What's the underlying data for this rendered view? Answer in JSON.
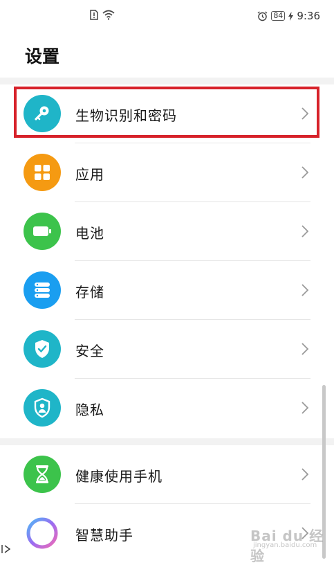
{
  "status_bar": {
    "time": "9:36",
    "battery": "84"
  },
  "header": {
    "title": "设置"
  },
  "settings": {
    "items": [
      {
        "label": "生物识别和密码",
        "icon": "key-icon",
        "color": "#1fb5c8"
      },
      {
        "label": "应用",
        "icon": "apps-grid-icon",
        "color": "#f59a12"
      },
      {
        "label": "电池",
        "icon": "battery-icon",
        "color": "#3cc34b"
      },
      {
        "label": "存储",
        "icon": "storage-icon",
        "color": "#1a9ef0"
      },
      {
        "label": "安全",
        "icon": "shield-check-icon",
        "color": "#1fb5c8"
      },
      {
        "label": "隐私",
        "icon": "privacy-shield-icon",
        "color": "#1fb5c8"
      }
    ],
    "items2": [
      {
        "label": "健康使用手机",
        "icon": "hourglass-icon",
        "color": "#3cc34b"
      },
      {
        "label": "智慧助手",
        "icon": "assistant-ring-icon",
        "color": "#8a6cf0"
      }
    ]
  },
  "highlight_color": "#d7222a",
  "watermark": {
    "text": "Bai du 经验",
    "sub": "jingyan.baidu.com"
  }
}
